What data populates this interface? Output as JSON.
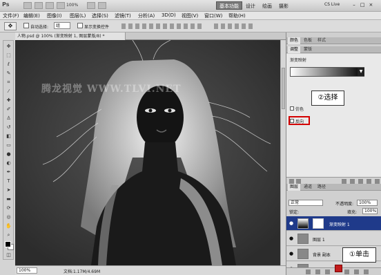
{
  "app": {
    "logo": "Ps",
    "zoom": "100%",
    "workspace_active": "基本功能",
    "workspace_links": [
      "设计",
      "绘画",
      "摄影"
    ],
    "cs_live": "CS Live"
  },
  "menu": [
    "文件(F)",
    "编辑(E)",
    "图像(I)",
    "图层(L)",
    "选择(S)",
    "滤镜(T)",
    "分析(A)",
    "3D(D)",
    "视图(V)",
    "窗口(W)",
    "帮助(H)"
  ],
  "options": {
    "auto_select_label": "自动选择:",
    "auto_select_value": "组",
    "show_transform_label": "显示变换控件"
  },
  "document": {
    "tab_title": "人物.psd @ 100% (渐变映射 1, 图层蒙版/8) *"
  },
  "watermark": "腾龙视觉 WWW.TLVI.NET",
  "status": {
    "zoom": "100%",
    "doc_info": "文档:1.17M/4.69M"
  },
  "panels": {
    "top_tabs": [
      "颜色",
      "色板",
      "样式"
    ],
    "adj_tabs": [
      "调整",
      "蒙版"
    ],
    "adjustment_title": "渐变映射",
    "dither_label": "仿色",
    "reverse_label": "反向",
    "layers_tabs": [
      "图层",
      "通道",
      "路径"
    ],
    "blend_mode": "正常",
    "opacity_label": "不透明度:",
    "opacity_value": "100%",
    "lock_label": "锁定:",
    "fill_label": "填充:",
    "fill_value": "100%",
    "layers": [
      {
        "name": "渐变映射 1",
        "selected": true
      },
      {
        "name": "图层 1",
        "selected": false
      },
      {
        "name": "背景 副本",
        "selected": false
      },
      {
        "name": "背景",
        "selected": false
      }
    ]
  },
  "annotations": {
    "step1": "①单击",
    "step2": "②选择"
  },
  "colors": {
    "selected_layer": "#1f3a8a",
    "highlight_red": "#d40000"
  }
}
